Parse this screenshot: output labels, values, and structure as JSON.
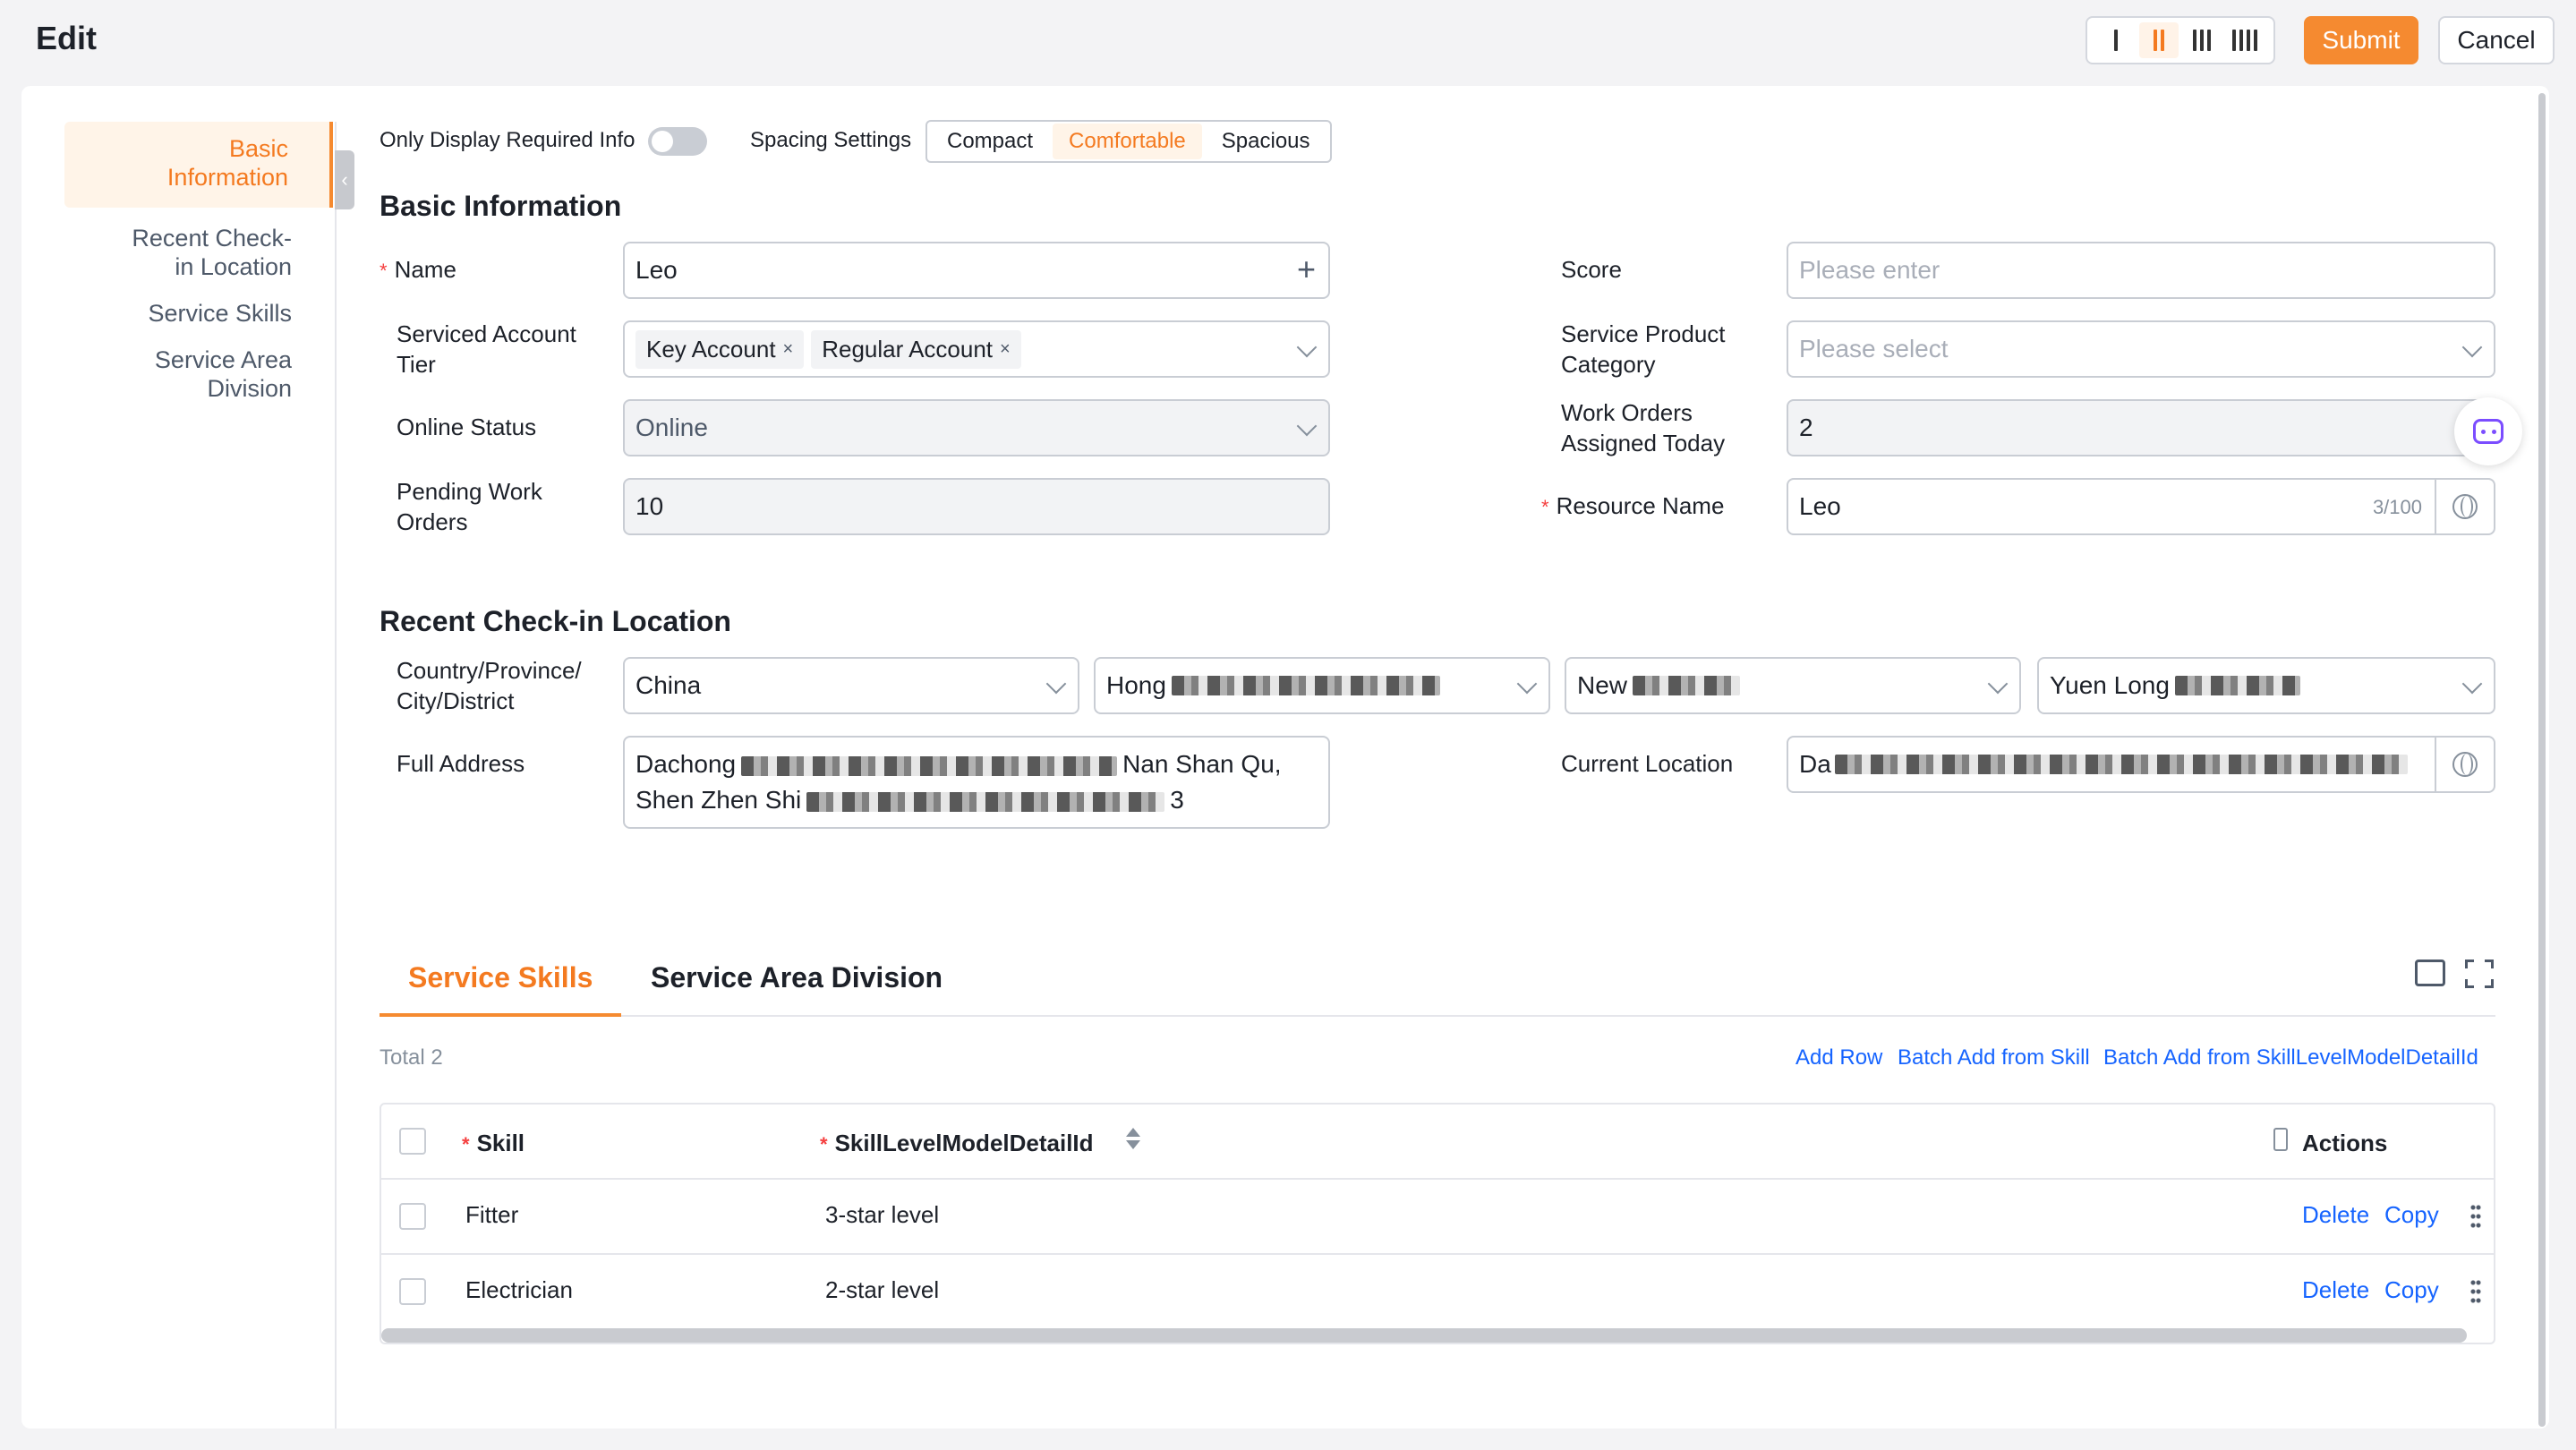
{
  "header": {
    "title": "Edit",
    "submit_label": "Submit",
    "cancel_label": "Cancel",
    "accent_color": "#f58a30"
  },
  "sidenav": {
    "items": [
      {
        "label": "Basic\nInformation",
        "active": true
      },
      {
        "label": "Recent Check-\nin Location"
      },
      {
        "label": "Service Skills"
      },
      {
        "label": "Service Area\nDivision"
      }
    ]
  },
  "options": {
    "required_only_label": "Only Display Required Info",
    "required_only_on": false,
    "spacing_label": "Spacing Settings",
    "spacing_options": [
      "Compact",
      "Comfortable",
      "Spacious"
    ],
    "spacing_selected": "Comfortable"
  },
  "basic": {
    "section_title": "Basic Information",
    "name_label": "Name",
    "name_value": "Leo",
    "tier_label": "Serviced Account\nTier",
    "tier_tags": [
      "Key Account",
      "Regular Account"
    ],
    "online_label": "Online Status",
    "online_value": "Online",
    "pending_label": "Pending Work\nOrders",
    "pending_value": "10",
    "score_label": "Score",
    "score_placeholder": "Please enter",
    "product_label": "Service Product\nCategory",
    "product_placeholder": "Please select",
    "today_label": "Work Orders\nAssigned Today",
    "today_value": "2",
    "resource_label": "Resource Name",
    "resource_value": "Leo",
    "resource_counter": "3/100"
  },
  "checkin": {
    "section_title": "Recent Check-in Location",
    "region_label": "Country/Province/\nCity/District",
    "country": "China",
    "province_prefix": "Hong",
    "city_prefix": "New",
    "district_prefix": "Yuen Long",
    "address_label": "Full Address",
    "address_line1_start": "Dachong",
    "address_line1_end": "Nan Shan Qu,",
    "address_line2_start": "Shen Zhen Shi",
    "address_line2_end": "3",
    "current_label": "Current Location",
    "current_prefix": "Da"
  },
  "tabs": {
    "items": [
      "Service Skills",
      "Service Area Division"
    ],
    "active": "Service Skills"
  },
  "table": {
    "total": "Total 2",
    "actions": [
      "Add Row",
      "Batch Add from Skill",
      "Batch Add from SkillLevelModelDetailId"
    ],
    "columns": {
      "skill": "Skill",
      "level": "SkillLevelModelDetailId",
      "actions": "Actions"
    },
    "rows": [
      {
        "skill": "Fitter",
        "level": "3-star level"
      },
      {
        "skill": "Electrician",
        "level": "2-star level"
      }
    ],
    "delete_label": "Delete",
    "copy_label": "Copy"
  }
}
